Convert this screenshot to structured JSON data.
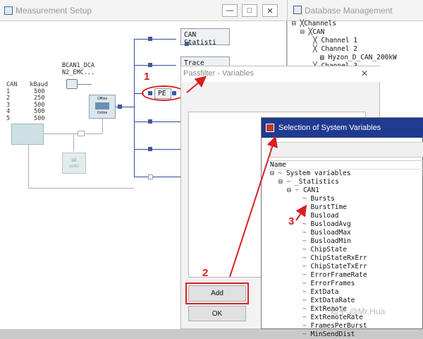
{
  "measurement_setup": {
    "title": "Measurement Setup",
    "can_table": {
      "headers": [
        "CAN",
        "kBaud"
      ],
      "rows": [
        [
          "1",
          "500"
        ],
        [
          "2",
          "250"
        ],
        [
          "3",
          "500"
        ],
        [
          "4",
          "500"
        ],
        [
          "5",
          "500"
        ]
      ]
    },
    "bcan_label_1": "BCAN1_DCA",
    "bcan_label_2": "N2_EMC...",
    "offline": "Offline",
    "online": "Online",
    "send": "SEND",
    "nodes": {
      "can_statistics": "CAN Statisti",
      "trace": "Trace",
      "pe": "PE"
    }
  },
  "database_management": {
    "title": "Database Management",
    "tree": [
      {
        "label": "Channels",
        "level": 0
      },
      {
        "label": "CAN",
        "level": 1
      },
      {
        "label": "Channel 1",
        "level": 2
      },
      {
        "label": "Channel 2",
        "level": 2
      },
      {
        "label": "Hyzon_D_CAN_200kW",
        "level": 3
      },
      {
        "label": "Channel 3",
        "level": 2
      }
    ]
  },
  "passfilter": {
    "title": "Passfilter - Variables",
    "add_label": "Add",
    "ok_label": "OK"
  },
  "system_variables": {
    "title": "Selection of System Variables",
    "column_header": "Name",
    "rows": [
      "System variables",
      "_Statistics",
      "CAN1",
      "Bursts",
      "BurstTime",
      "Busload",
      "BusloadAvg",
      "BusloadMax",
      "BusloadMin",
      "ChipState",
      "ChipStateRxErr",
      "ChipStateTxErr",
      "ErrorFrameRate",
      "ErrorFrames",
      "ExtData",
      "ExtDataRate",
      "ExtRemote",
      "ExtRemoteRate",
      "FramesPerBurst",
      "MinSendDist"
    ]
  },
  "annotations": {
    "n1": "1",
    "n2": "2",
    "n3": "3"
  },
  "watermark": "知乎 @Mr.Hua",
  "colors": {
    "accent_red": "#d92020",
    "title_blue": "#1f3b8f",
    "connector": "#2f4a9a"
  }
}
